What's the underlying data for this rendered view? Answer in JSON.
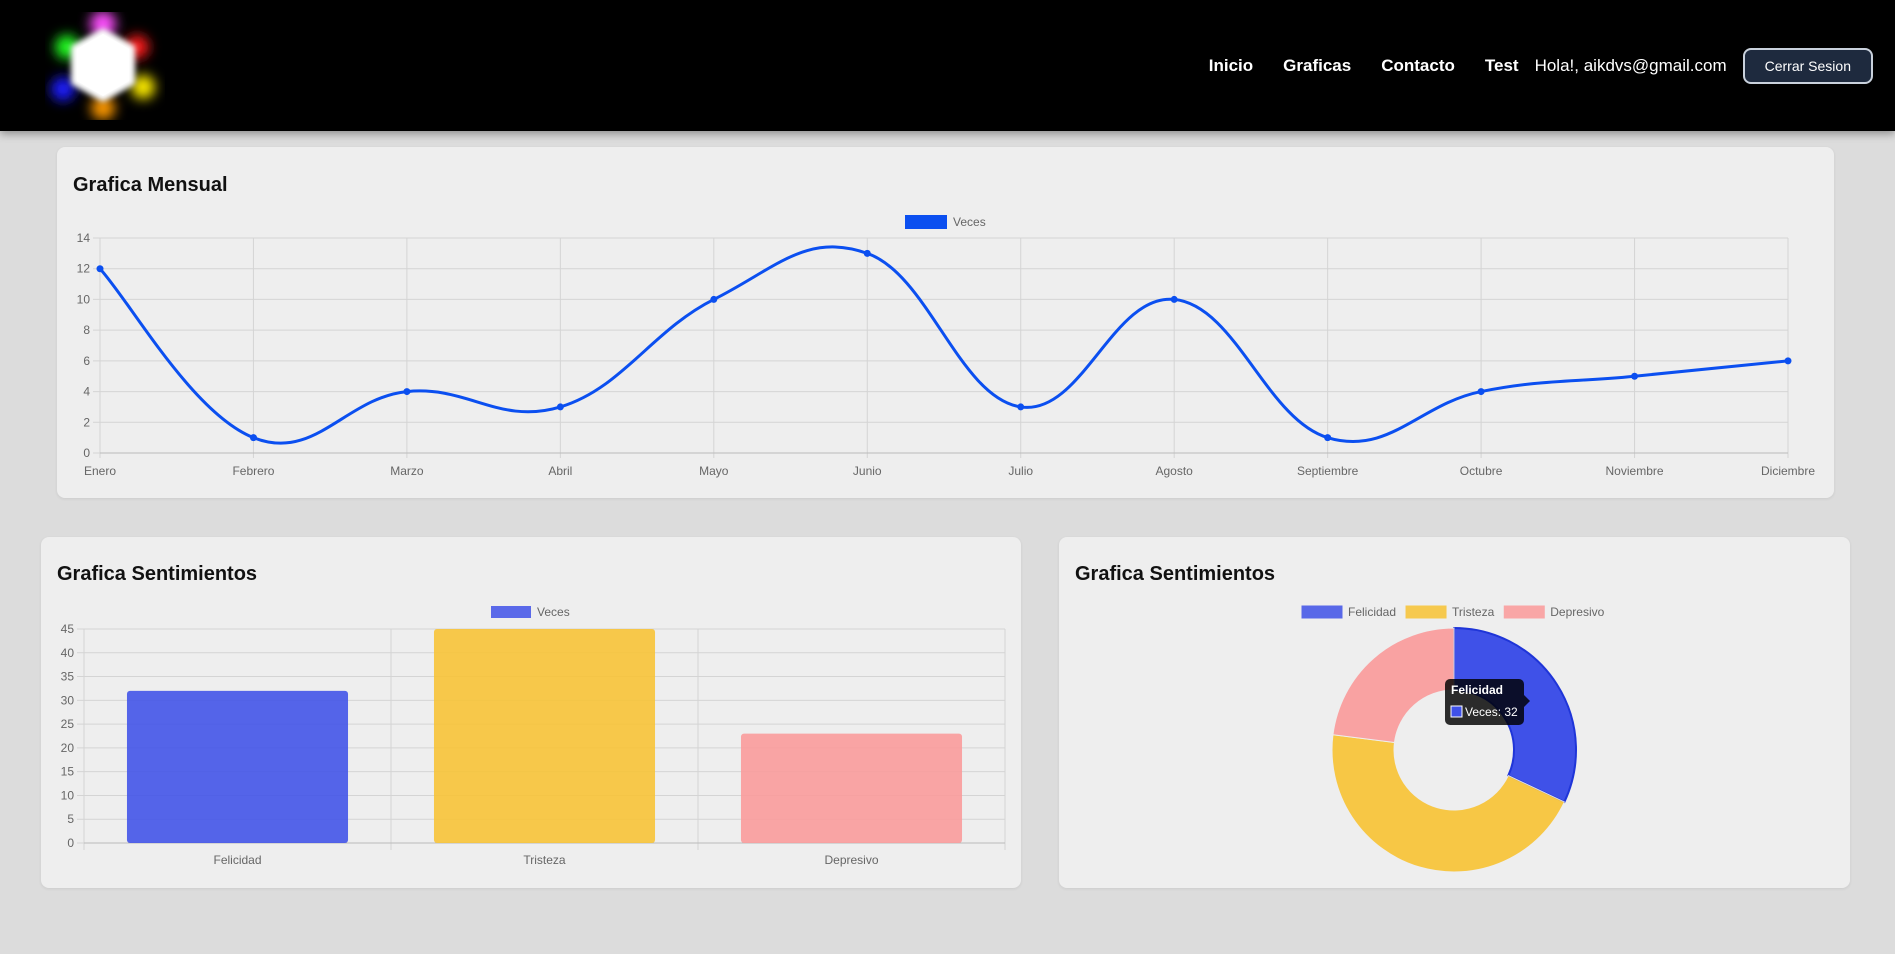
{
  "nav": {
    "links": [
      "Inicio",
      "Graficas",
      "Contacto",
      "Test"
    ],
    "greeting": "Hola!, aikdvs@gmail.com",
    "logout_label": "Cerrar Sesion"
  },
  "cards": {
    "monthly_title": "Grafica Mensual",
    "bar_title": "Grafica Sentimientos",
    "doughnut_title": "Grafica Sentimientos"
  },
  "colors": {
    "line": "#0b4ff0",
    "felicidad": "#3f51e8",
    "tristeza": "#f8c333",
    "depresivo": "#fb9a9a"
  },
  "chart_data": [
    {
      "type": "line",
      "title": "Grafica Mensual",
      "categories": [
        "Enero",
        "Febrero",
        "Marzo",
        "Abril",
        "Mayo",
        "Junio",
        "Julio",
        "Agosto",
        "Septiembre",
        "Octubre",
        "Noviembre",
        "Diciembre"
      ],
      "series": [
        {
          "name": "Veces",
          "values": [
            12,
            1,
            4,
            3,
            10,
            13,
            3,
            10,
            1,
            4,
            5,
            6
          ]
        }
      ],
      "ylim": [
        0,
        14
      ],
      "yticks": [
        0,
        2,
        4,
        6,
        8,
        10,
        12,
        14
      ],
      "grid": true,
      "legend": "top-center"
    },
    {
      "type": "bar",
      "title": "Grafica Sentimientos",
      "categories": [
        "Felicidad",
        "Tristeza",
        "Depresivo"
      ],
      "series": [
        {
          "name": "Veces",
          "values": [
            32,
            45,
            23
          ]
        }
      ],
      "ylim": [
        0,
        45
      ],
      "yticks": [
        0,
        5,
        10,
        15,
        20,
        25,
        30,
        35,
        40,
        45
      ],
      "grid": true,
      "legend": "top-center"
    },
    {
      "type": "pie",
      "title": "Grafica Sentimientos",
      "categories": [
        "Felicidad",
        "Tristeza",
        "Depresivo"
      ],
      "values": [
        32,
        45,
        23
      ],
      "legend": "top-center",
      "tooltip": {
        "title": "Felicidad",
        "label": "Veces: 32"
      }
    }
  ]
}
